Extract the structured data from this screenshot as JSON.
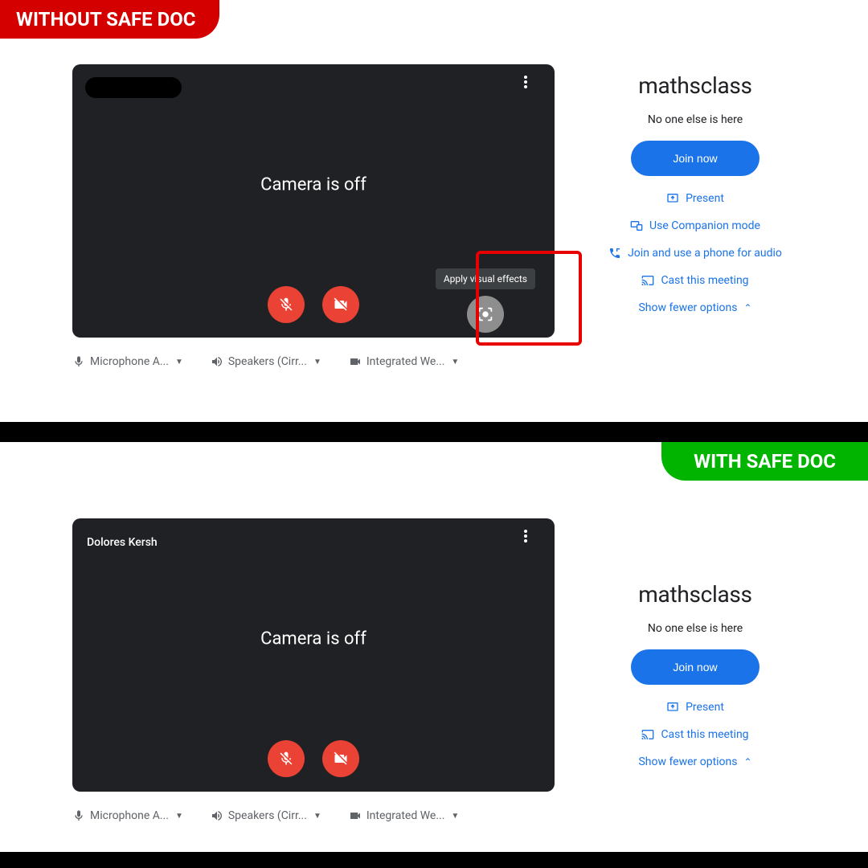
{
  "tags": {
    "without": "WITHOUT SAFE DOC",
    "with": "WITH SAFE DOC"
  },
  "top": {
    "cameraOff": "Camera is off",
    "tooltip": "Apply visual effects",
    "devices": {
      "mic": "Microphone A...",
      "speaker": "Speakers (Cirr...",
      "camera": "Integrated We..."
    },
    "meetingTitle": "mathsclass",
    "subText": "No one else is here",
    "joinLabel": "Join now",
    "options": {
      "present": "Present",
      "companion": "Use Companion mode",
      "phone": "Join and use a phone for audio",
      "cast": "Cast this meeting",
      "fewer": "Show fewer options"
    }
  },
  "bottom": {
    "userName": "Dolores Kersh",
    "cameraOff": "Camera is off",
    "devices": {
      "mic": "Microphone A...",
      "speaker": "Speakers (Cirr...",
      "camera": "Integrated We..."
    },
    "meetingTitle": "mathsclass",
    "subText": "No one else is here",
    "joinLabel": "Join now",
    "options": {
      "present": "Present",
      "cast": "Cast this meeting",
      "fewer": "Show fewer options"
    }
  }
}
